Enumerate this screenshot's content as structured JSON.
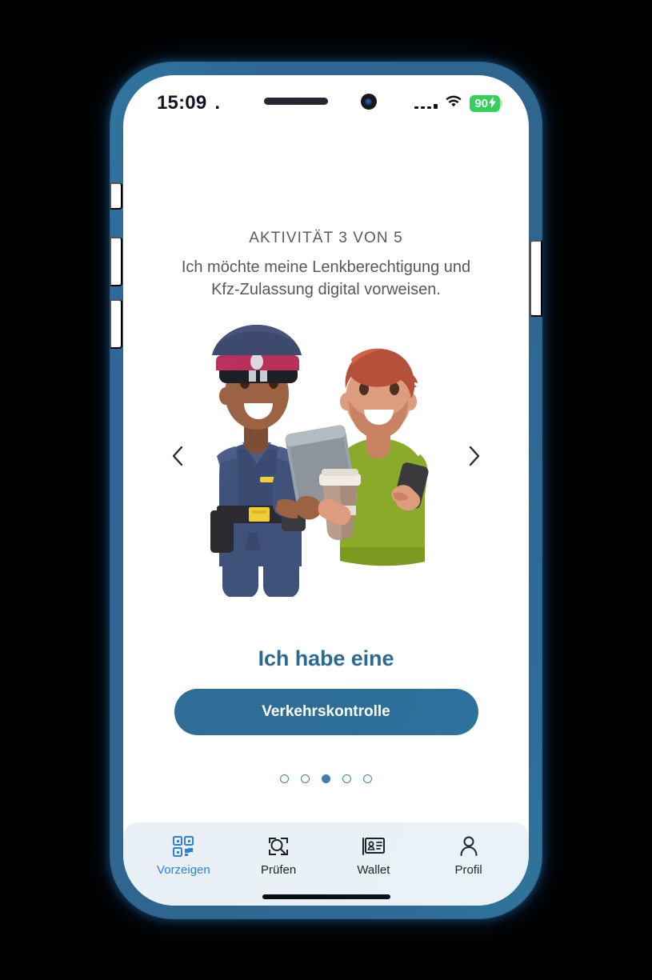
{
  "status_bar": {
    "time": "15:09",
    "time_suffix": ".",
    "signal_icon": "cellular-signal-icon",
    "wifi_icon": "wifi-icon",
    "battery_level": "90",
    "battery_charging_icon": "lightning-bolt-icon",
    "battery_color": "#32d15a"
  },
  "hardware": {
    "speaker_slot": "speaker-slot",
    "front_camera": "front-camera",
    "frame_color": "#2f6690"
  },
  "main": {
    "activity_label": "AKTIVITÄT 3 VON 5",
    "activity_description": "Ich möchte meine Lenkberechtigung und Kfz-Zulassung digital vorweisen.",
    "illustration_alt": "Polizist mit Tablet und Mann mit Smartphone und Kaffeebecher",
    "prev_arrow_icon": "chevron-left-icon",
    "next_arrow_icon": "chevron-right-icon"
  },
  "cta": {
    "headline": "Ich habe eine",
    "button_label": "Verkehrskontrolle",
    "button_color": "#2d6d96",
    "headline_color": "#2b6a92"
  },
  "pagination": {
    "total": 5,
    "active_index": 2,
    "dot_color": "#3f7da6"
  },
  "bottom_nav": {
    "background_color": "#eaf1f6",
    "active_color": "#2f7fe0",
    "items": [
      {
        "label": "Vorzeigen",
        "icon": "qr-code-icon",
        "active": true
      },
      {
        "label": "Prüfen",
        "icon": "scan-magnifier-icon",
        "active": false
      },
      {
        "label": "Wallet",
        "icon": "id-card-icon",
        "active": false
      },
      {
        "label": "Profil",
        "icon": "person-icon",
        "active": false
      }
    ]
  },
  "illustration_colors": {
    "officer_cap_navy": "#3d4a6b",
    "officer_cap_band": "#b93158",
    "officer_skin": "#9c6242",
    "officer_uniform": "#41527a",
    "officer_belt": "#2b2b2f",
    "officer_buckle": "#f2cd3a",
    "man_hair": "#b5513a",
    "man_skin": "#dd9c7d",
    "man_sweater": "#8aaa2a",
    "tablet_gray": "#8d949c",
    "coffee_cup": "#b99e8f"
  }
}
